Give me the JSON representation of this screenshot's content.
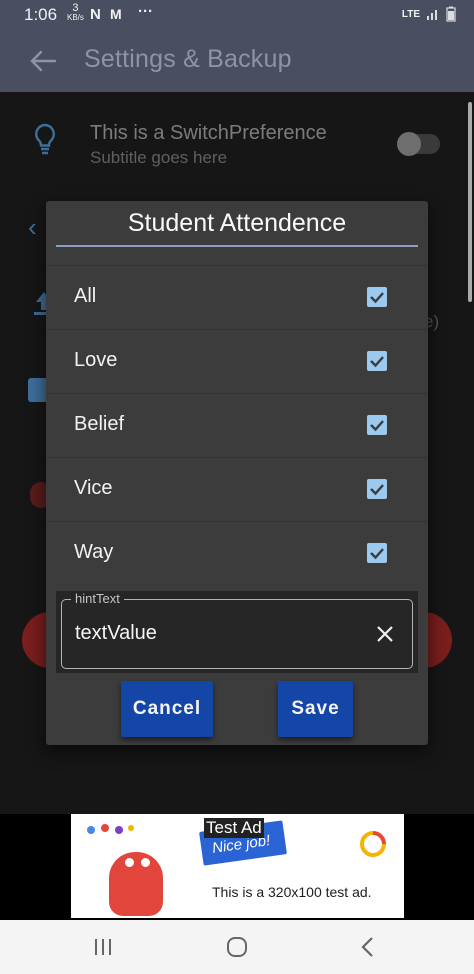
{
  "status": {
    "time": "1:06",
    "data_speed_value": "3",
    "data_speed_unit": "KB/s",
    "notif_icons": [
      "netflix-n-icon",
      "gmail-icon",
      "more-icon"
    ],
    "network": "LTE",
    "icons": [
      "lte-icon",
      "signal-icon",
      "battery-icon"
    ]
  },
  "appbar": {
    "title": "Settings & Backup",
    "back_icon": "arrow-back-icon"
  },
  "background": {
    "switch_pref_title": "This is a SwitchPreference",
    "switch_pref_subtitle": "Subtitle goes here",
    "switch_on": false,
    "partial_text": "e)"
  },
  "dialog": {
    "title": "Student Attendence",
    "items": [
      {
        "label": "All",
        "checked": true
      },
      {
        "label": "Love",
        "checked": true
      },
      {
        "label": "Belief",
        "checked": true
      },
      {
        "label": "Vice",
        "checked": true
      },
      {
        "label": "Way",
        "checked": true
      }
    ],
    "field": {
      "hint": "hintText",
      "value": "textValue",
      "clear_icon": "close-icon"
    },
    "cancel_label": "Cancel",
    "save_label": "Save"
  },
  "ad": {
    "tag": "Test Ad",
    "ribbon_text": "Nice job!",
    "caption": "This is a 320x100 test ad."
  },
  "navbar": {
    "icons": [
      "recents-icon",
      "home-icon",
      "back-icon"
    ]
  },
  "colors": {
    "appbar": "#4a4e61",
    "dialog": "#3c3c3c",
    "checkbox": "#9bc9f0",
    "button": "#1446a8"
  }
}
